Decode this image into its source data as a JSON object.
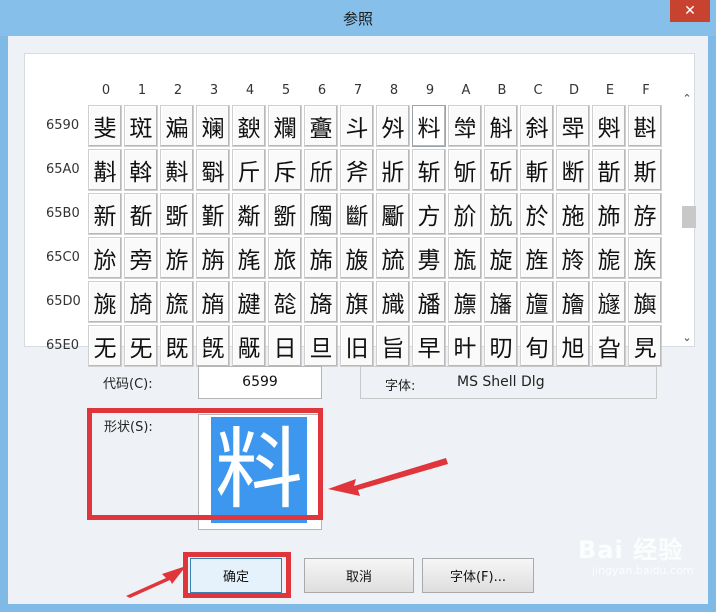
{
  "window": {
    "title": "参照",
    "close_glyph": "✕"
  },
  "grid": {
    "columns": [
      "0",
      "1",
      "2",
      "3",
      "4",
      "5",
      "6",
      "7",
      "8",
      "9",
      "A",
      "B",
      "C",
      "D",
      "E",
      "F"
    ],
    "rows": [
      {
        "code": "6590",
        "chars": [
          "斐",
          "斑",
          "斒",
          "斓",
          "斔",
          "斕",
          "斖",
          "斗",
          "斘",
          "料",
          "斚",
          "斛",
          "斜",
          "斝",
          "斞",
          "斟"
        ]
      },
      {
        "code": "65A0",
        "chars": [
          "斠",
          "斡",
          "斢",
          "斣",
          "斤",
          "斥",
          "斦",
          "斧",
          "斨",
          "斩",
          "斪",
          "斫",
          "斬",
          "断",
          "斮",
          "斯"
        ]
      },
      {
        "code": "65B0",
        "chars": [
          "新",
          "斱",
          "斲",
          "斳",
          "斴",
          "斵",
          "斶",
          "斷",
          "斸",
          "方",
          "斺",
          "斻",
          "於",
          "施",
          "斾",
          "斿"
        ]
      },
      {
        "code": "65C0",
        "chars": [
          "旀",
          "旁",
          "旂",
          "旃",
          "旄",
          "旅",
          "旆",
          "旇",
          "旈",
          "旉",
          "旊",
          "旋",
          "旌",
          "旍",
          "旎",
          "族"
        ]
      },
      {
        "code": "65D0",
        "chars": [
          "旐",
          "旑",
          "旒",
          "旓",
          "旔",
          "旕",
          "旖",
          "旗",
          "旘",
          "旙",
          "旚",
          "旛",
          "旜",
          "旝",
          "旞",
          "旟"
        ]
      },
      {
        "code": "65E0",
        "chars": [
          "无",
          "旡",
          "既",
          "旣",
          "旤",
          "日",
          "旦",
          "旧",
          "旨",
          "早",
          "旪",
          "旫",
          "旬",
          "旭",
          "旮",
          "旯"
        ]
      }
    ],
    "selected": {
      "row": 0,
      "col": 9
    }
  },
  "code": {
    "label": "代码(C):",
    "value": "6599"
  },
  "font": {
    "label": "字体:",
    "value": "MS Shell Dlg"
  },
  "shape": {
    "label": "形状(S):",
    "glyph": "料"
  },
  "buttons": {
    "ok": "确定",
    "cancel": "取消",
    "font": "字体(F)..."
  },
  "watermark": {
    "main": "Bai 经验",
    "sub": "jingyan.baidu.com"
  },
  "colors": {
    "highlight": "#e0353b",
    "selection": "#3d97ee"
  }
}
